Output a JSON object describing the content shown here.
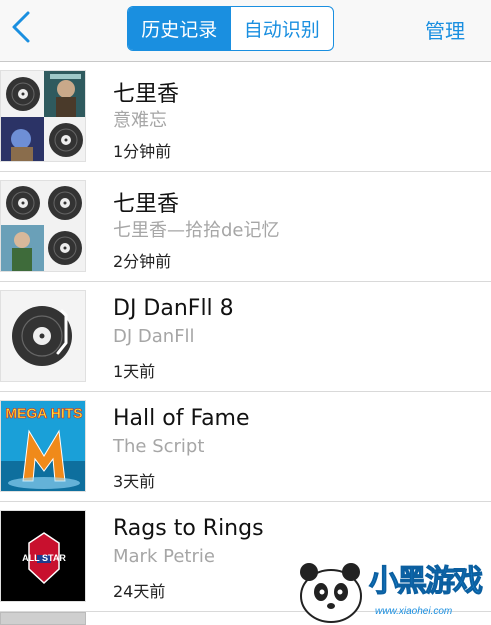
{
  "nav": {
    "tab_history": "历史记录",
    "tab_auto": "自动识别",
    "manage": "管理"
  },
  "items": [
    {
      "title": "七里香",
      "artist": "意难忘",
      "time": "1分钟前"
    },
    {
      "title": "七里香",
      "artist": "七里香—拾拾de记忆",
      "time": "2分钟前"
    },
    {
      "title": "DJ DanFll 8",
      "artist": "DJ DanFll",
      "time": "1天前"
    },
    {
      "title": "Hall of Fame",
      "artist": "The Script",
      "time": "3天前",
      "art_text": "MEGA HITS"
    },
    {
      "title": "Rags to Rings",
      "artist": "Mark Petrie",
      "time": "24天前",
      "art_text": "ALL STAR"
    }
  ],
  "watermark": {
    "brand": "小黑游戏",
    "url": "www.xiaohei.com"
  },
  "colors": {
    "accent": "#1a8fe0",
    "secondary_text": "#a6a6a6"
  }
}
